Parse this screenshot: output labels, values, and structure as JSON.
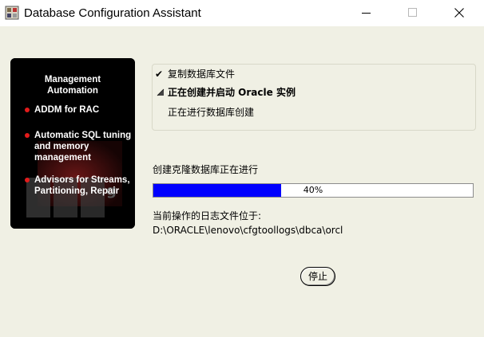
{
  "window": {
    "title": "Database Configuration Assistant",
    "icon": "database-app-icon"
  },
  "side_panel": {
    "heading": "Management\nAutomation",
    "items": [
      "ADDM for RAC",
      "Automatic SQL tuning and memory management",
      "Advisors for Streams, Partitioning, Repair"
    ],
    "bullet_color": "#e31b1b"
  },
  "steps": [
    {
      "mark": "✔",
      "label": "复制数据库文件",
      "state": "completed"
    },
    {
      "mark": "▶",
      "label": "正在创建并启动 Oracle 实例",
      "state": "in-progress"
    },
    {
      "mark": "",
      "label": "正在进行数据库创建",
      "state": "pending"
    }
  ],
  "progress": {
    "label": "创建克隆数据库正在进行",
    "percent_text": "40%",
    "fraction": 0.4,
    "bar_color": "#0000ff"
  },
  "log": {
    "label": "当前操作的日志文件位于:",
    "path": "D:\\ORACLE\\lenovo\\cfgtoollogs\\dbca\\orcl"
  },
  "buttons": {
    "stop": "停止"
  }
}
